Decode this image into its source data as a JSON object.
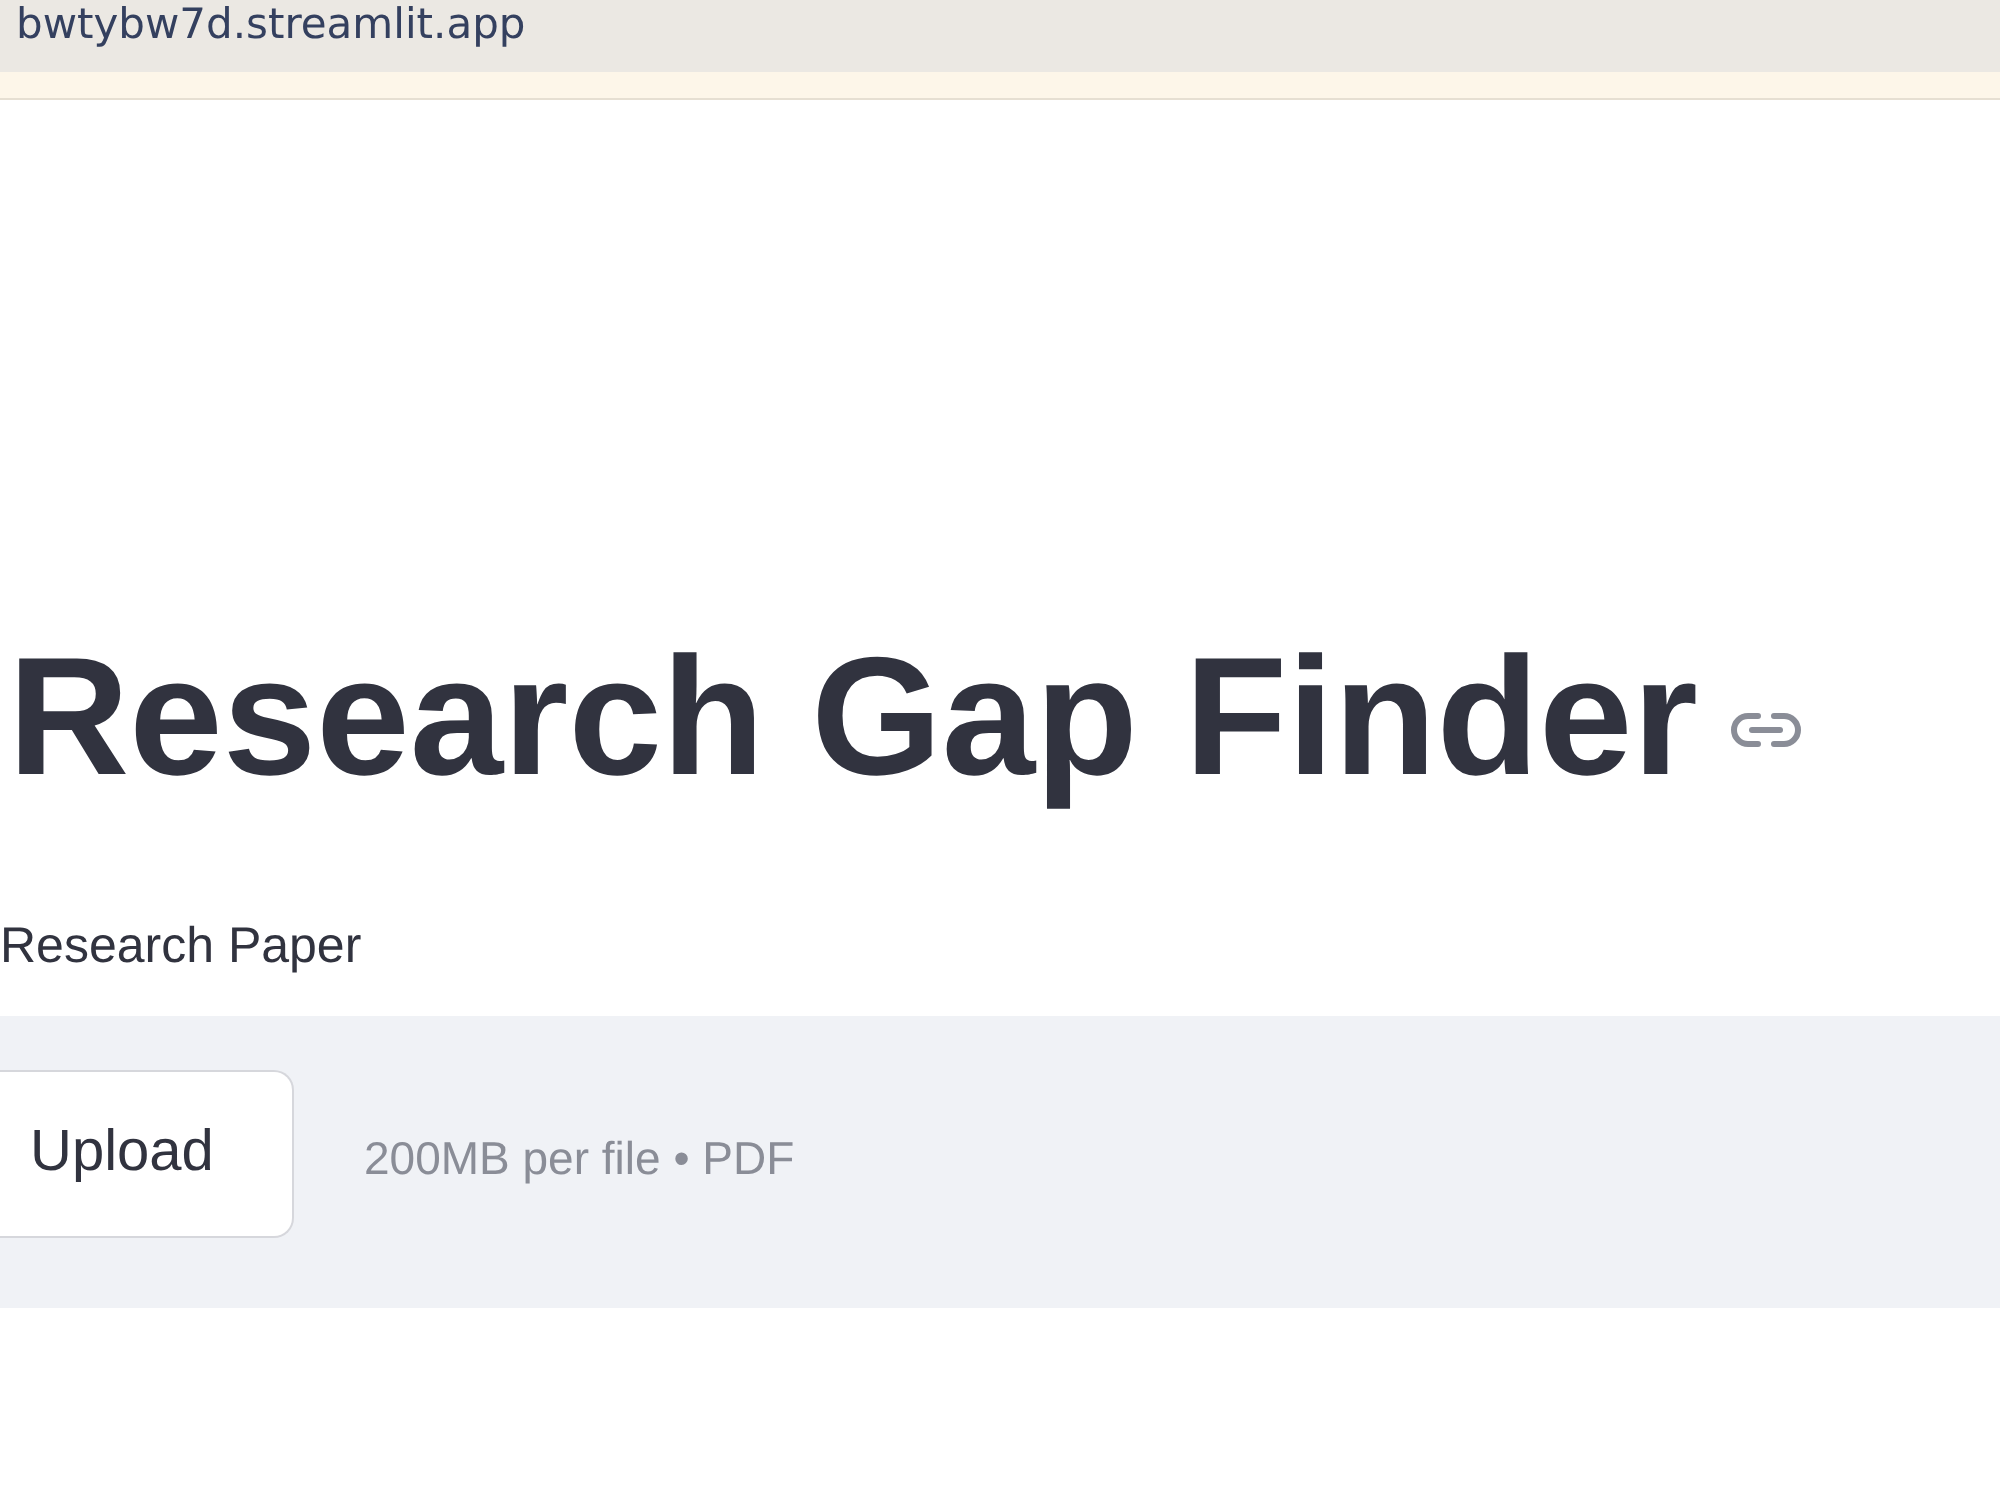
{
  "browser": {
    "address": "bwtybw7d.streamlit.app"
  },
  "page": {
    "title": "Research Gap Finder"
  },
  "file_uploader": {
    "label": "Research Paper",
    "button": "Upload",
    "hint": "200MB per file • PDF"
  }
}
